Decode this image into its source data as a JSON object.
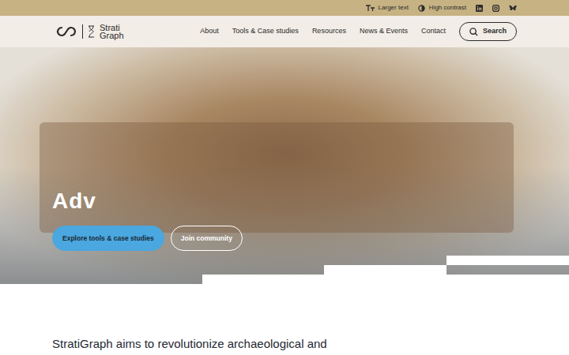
{
  "utility": [
    {
      "label": "Larger text",
      "kind": "text-size"
    },
    {
      "label": "High contrast",
      "kind": "contrast"
    }
  ],
  "social": [
    {
      "kind": "linkedin"
    },
    {
      "kind": "instagram"
    },
    {
      "kind": "bluesky"
    }
  ],
  "logo": {
    "line1": "Strati",
    "line2": "Graph"
  },
  "nav": [
    {
      "label": "About"
    },
    {
      "label": "Tools & Case studies"
    },
    {
      "label": "Resources"
    },
    {
      "label": "News & Events"
    },
    {
      "label": "Contact"
    }
  ],
  "search": {
    "label": "Search"
  },
  "hero": {
    "title": "Adv",
    "buttons": [
      {
        "label": "Explore tools & case studies",
        "kind": "primary"
      },
      {
        "label": "Join community",
        "kind": "outline"
      }
    ]
  },
  "intro": {
    "text": "StratiGraph aims to revolutionize archaeological and"
  }
}
